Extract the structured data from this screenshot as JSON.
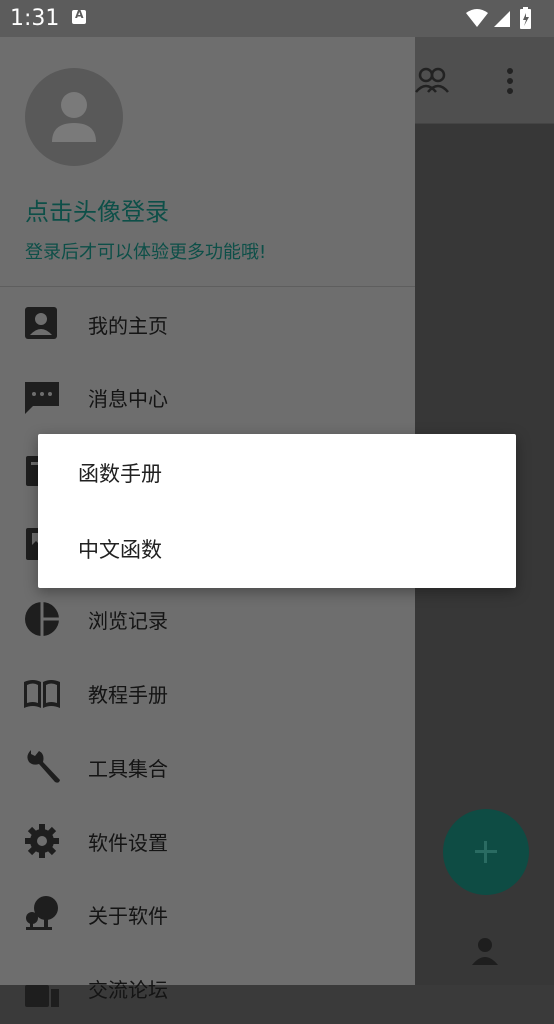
{
  "status_bar": {
    "time": "1:31",
    "notification_icon": "a-icon",
    "system_icons": [
      "wifi-icon",
      "signal-icon",
      "battery-charging-icon"
    ]
  },
  "drawer": {
    "login_title": "点击头像登录",
    "login_subtitle": "登录后才可以体验更多功能哦!",
    "menu_items": [
      {
        "label": "我的主页",
        "icon": "account-box-icon"
      },
      {
        "label": "消息中心",
        "icon": "message-icon"
      },
      {
        "label": "",
        "icon": "document-icon"
      },
      {
        "label": "",
        "icon": "bookmark-icon"
      },
      {
        "label": "浏览记录",
        "icon": "pie-chart-icon"
      },
      {
        "label": "教程手册",
        "icon": "book-open-icon"
      },
      {
        "label": "工具集合",
        "icon": "wrench-icon"
      },
      {
        "label": "软件设置",
        "icon": "gear-icon"
      },
      {
        "label": "关于软件",
        "icon": "tree-info-icon"
      },
      {
        "label": "交流论坛",
        "icon": "forum-icon"
      }
    ]
  },
  "dialog": {
    "options": [
      "函数手册",
      "中文函数"
    ]
  },
  "app": {
    "fab_icon": "plus-icon",
    "toolbar_icons": [
      "people-icon",
      "more-vert-icon"
    ],
    "bottom_nav_icon": "person-icon"
  },
  "colors": {
    "accent": "#0d4f48",
    "drawer_dimmed": "#6e6e6e",
    "dialog_bg": "#ffffff"
  }
}
